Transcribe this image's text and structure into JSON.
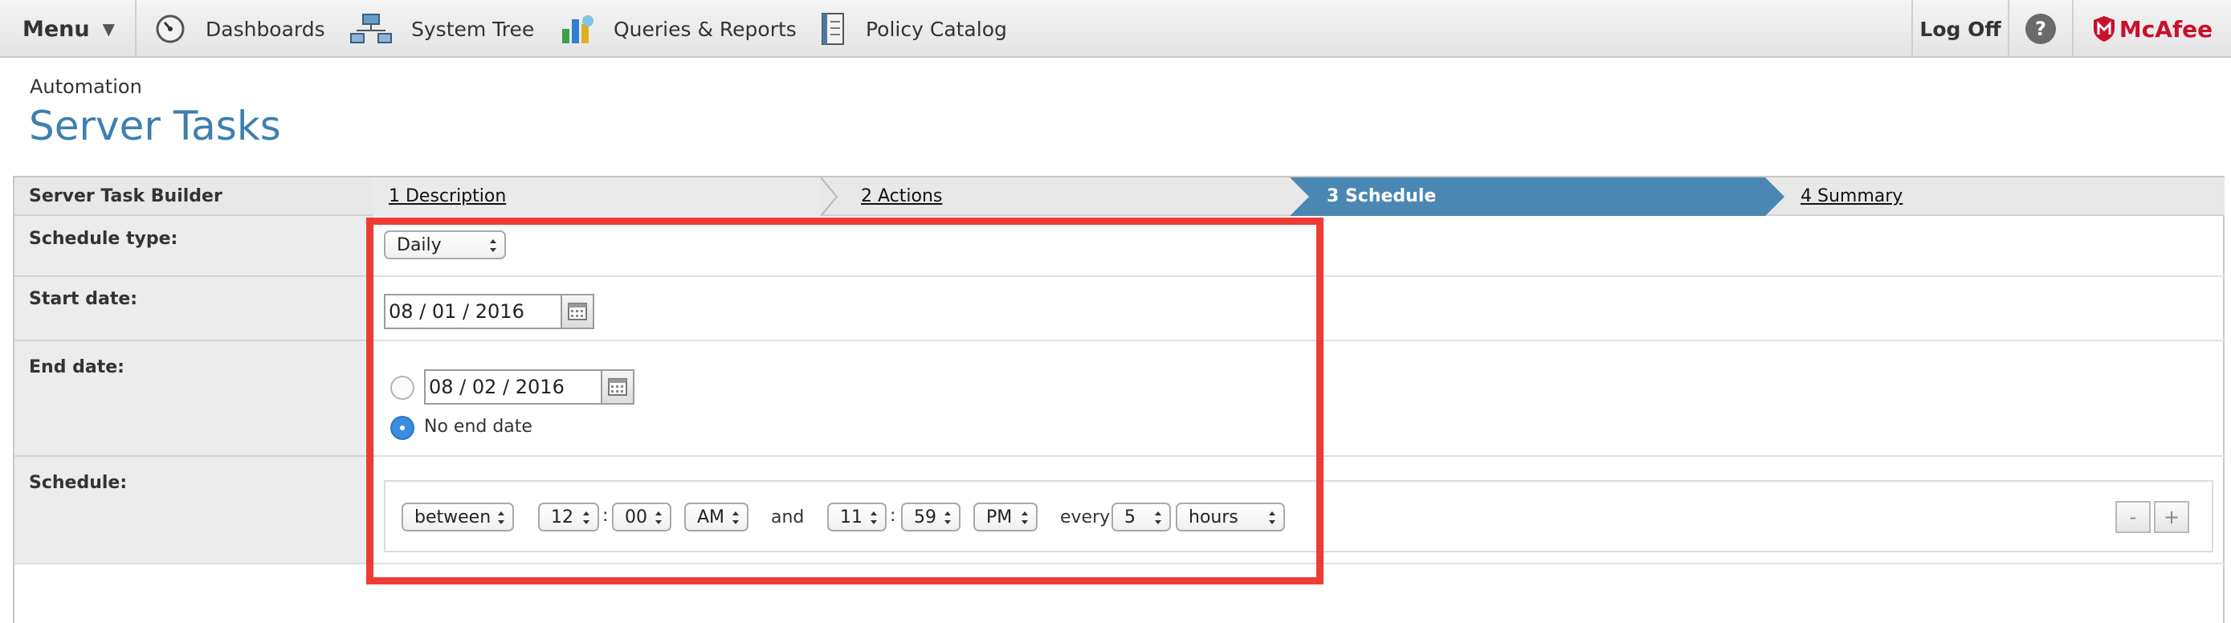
{
  "topbar": {
    "menu_label": "Menu",
    "nav": [
      {
        "label": "Dashboards",
        "icon": "gauge-icon"
      },
      {
        "label": "System Tree",
        "icon": "network-icon"
      },
      {
        "label": "Queries & Reports",
        "icon": "chart-icon"
      },
      {
        "label": "Policy Catalog",
        "icon": "catalog-icon"
      }
    ],
    "logoff_label": "Log Off",
    "help_label": "?",
    "brand": "McAfee"
  },
  "page": {
    "breadcrumb": "Automation",
    "title": "Server Tasks"
  },
  "wizard": {
    "title": "Server Task Builder",
    "steps": [
      "1 Description",
      "2 Actions",
      "3 Schedule",
      "4 Summary"
    ],
    "active_step": 3
  },
  "form": {
    "schedule_type_label": "Schedule type:",
    "schedule_type_value": "Daily",
    "start_date_label": "Start date:",
    "start_date_value": "08 / 01 / 2016",
    "end_date_label": "End date:",
    "end_date_value": "08 / 02 / 2016",
    "no_end_date_label": "No end date",
    "end_date_selected": "No end date",
    "schedule_label": "Schedule:",
    "schedule": {
      "mode": "between",
      "start_hour": "12",
      "start_minute": "00",
      "start_ampm": "AM",
      "and_label": "and",
      "end_hour": "11",
      "end_minute": "59",
      "end_ampm": "PM",
      "every_label": "every",
      "interval": "5",
      "unit": "hours",
      "colon": ":"
    },
    "remove_label": "-",
    "add_label": "+"
  },
  "colors": {
    "accent": "#3d7fae",
    "active_step": "#4a87b2",
    "highlight": "#ee3c34",
    "brand_red": "#c8102e"
  }
}
